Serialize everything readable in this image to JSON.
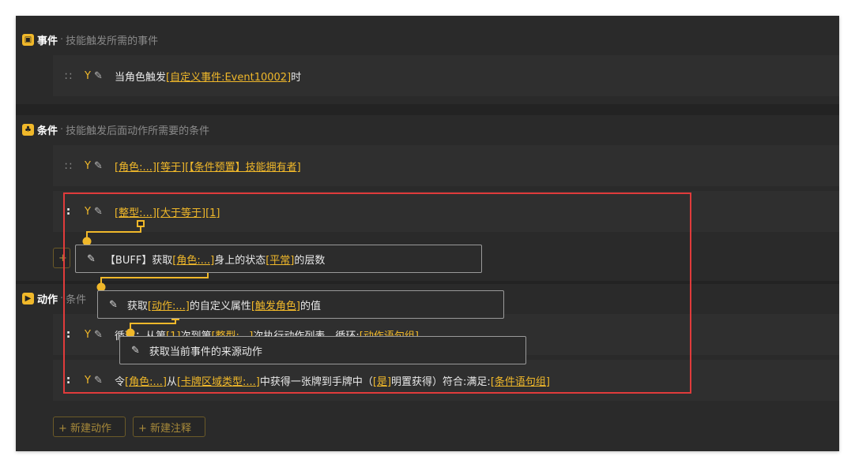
{
  "event_section": {
    "icon": "▣",
    "title": "事件",
    "separator": "·",
    "subtitle": "技能触发所需的事件"
  },
  "event_row": {
    "handle": "::",
    "text_pre": "当角色触发",
    "link1": "[自定义事件:Event10002]",
    "text_post": "时"
  },
  "condition_section": {
    "icon": "♣",
    "title": "条件",
    "separator": "·",
    "subtitle": "技能触发后面动作所需要的条件"
  },
  "condition_row1": {
    "handle": "::",
    "link1": "[角色:...]",
    "link2": "[等于]",
    "link3": "[【条件预置】技能拥有者]"
  },
  "condition_row2": {
    "handle": ":",
    "link1": "[整型:...]",
    "link2": "[大于等于]",
    "link3": "[1]"
  },
  "action_section": {
    "icon": "▶",
    "title": "动作",
    "separator": "·",
    "subtitle": "条件"
  },
  "action_row1": {
    "handle": ":",
    "text_a": "循环：从第",
    "link1": "[1]",
    "text_b": "次到第",
    "link2": "[整型:...]",
    "text_c": "次执行动作列表，循环:",
    "link3": "[动作语句组]"
  },
  "action_row2": {
    "handle": ":",
    "text_a": "令",
    "link1": "[角色:...]",
    "text_b": "从",
    "link2": "[卡牌区域类型:...]",
    "text_c": "中获得一张牌到手牌中（",
    "link3": "[是]",
    "text_d": "明置获得）符合:满足:",
    "link4": "[条件语句组]"
  },
  "popup1": {
    "text_a": "【BUFF】获取",
    "link1": "[角色:...]",
    "text_b": "身上的状态",
    "link2": "[平常]",
    "text_c": "的层数"
  },
  "popup2": {
    "text_a": "获取",
    "link1": "[动作:...]",
    "text_b": "的自定义属性",
    "link2": "[触发角色]",
    "text_c": "的值"
  },
  "popup3": {
    "text_a": "获取当前事件的来源动作"
  },
  "buttons": {
    "new_action": "+ 新建动作",
    "new_note": "+ 新建注释"
  },
  "icons": {
    "tool": "Y",
    "pen": "✎"
  },
  "colors": {
    "accent": "#f0b82a",
    "highlight": "#e03b3b",
    "panel": "#232323"
  }
}
